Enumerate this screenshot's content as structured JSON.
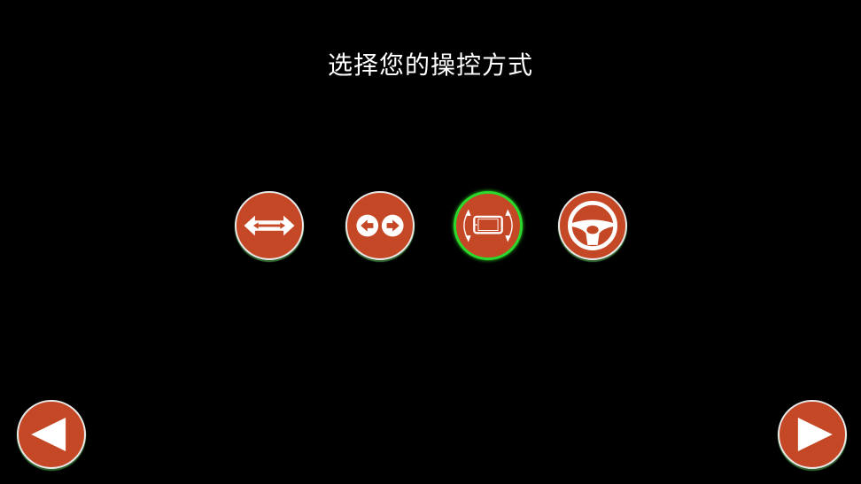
{
  "title": "选择您的操控方式",
  "controls": [
    {
      "icon": "two-way-arrow-icon",
      "selected": false
    },
    {
      "icon": "left-right-buttons-icon",
      "selected": false
    },
    {
      "icon": "tilt-phone-icon",
      "selected": true
    },
    {
      "icon": "steering-wheel-icon",
      "selected": false
    }
  ],
  "nav": {
    "prev_icon": "left-triangle-icon",
    "next_icon": "right-triangle-icon"
  },
  "colors": {
    "button_fill": "#c54826",
    "button_ring": "#e8e8e8",
    "selected_ring": "#2bd82b",
    "background": "#000000",
    "text": "#ffffff"
  }
}
